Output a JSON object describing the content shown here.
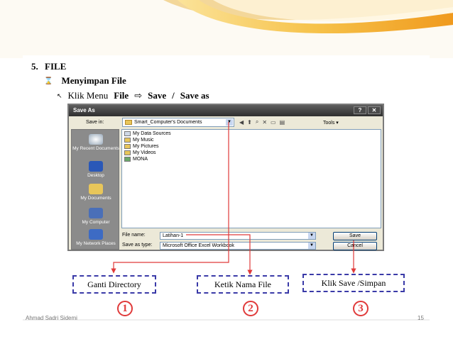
{
  "heading": {
    "number": "5.",
    "title": "FILE"
  },
  "bullet1": {
    "text": "Menyimpan  File"
  },
  "bullet2": {
    "prefix": "Klik Menu",
    "menu": "File",
    "item1": "Save",
    "sep": "/",
    "item2": "Save as"
  },
  "dialog": {
    "title": "Save As",
    "save_in_label": "Save in:",
    "save_in_value": "Smart_Computer's Documents",
    "tools_label": "Tools",
    "places": [
      "My Recent Documents",
      "Desktop",
      "My Documents",
      "My Computer",
      "My Network Places"
    ],
    "files": [
      "My Data Sources",
      "My Music",
      "My Pictures",
      "My Videos",
      "MONA"
    ],
    "file_name_label": "File name:",
    "file_name_value": "Latihan-1",
    "save_type_label": "Save as type:",
    "save_type_value": "Microsoft Office Excel Workbook",
    "save_button": "Save",
    "cancel_button": "Cancel"
  },
  "callouts": [
    {
      "text": "Ganti Directory",
      "number": "1"
    },
    {
      "text": "Ketik Nama File",
      "number": "2"
    },
    {
      "text": "Klik Save /Simpan",
      "number": "3"
    }
  ],
  "footer": {
    "left": "Ahmad Sadri Sidemi",
    "right": "15"
  },
  "colors": {
    "callout_border": "#3a3aa8",
    "arrow": "#e03a3a",
    "number": "#e03a3a",
    "curl": "#f2b33d"
  }
}
